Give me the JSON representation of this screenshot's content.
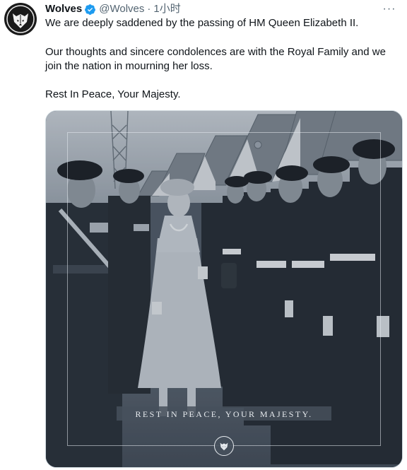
{
  "tweet": {
    "author_name": "Wolves",
    "handle": "@Wolves",
    "separator": "·",
    "time": "1小时",
    "more_label": "···",
    "verified_icon": "verified-badge-icon",
    "avatar_icon": "wolf-head-logo",
    "paragraphs": [
      "We are deeply saddened by the passing of HM Queen Elizabeth II.",
      "Our thoughts and sincere condolences are with the Royal Family and we join the nation in mourning her loss.",
      "Rest In Peace, Your Majesty."
    ]
  },
  "media": {
    "caption": "REST IN PEACE, YOUR MAJESTY.",
    "badge_icon": "wolf-head-logo",
    "tint": "#4b5561"
  },
  "colors": {
    "text": "#0f1419",
    "secondary": "#536471",
    "verified": "#1d9bf0",
    "border": "#cfd9de"
  }
}
